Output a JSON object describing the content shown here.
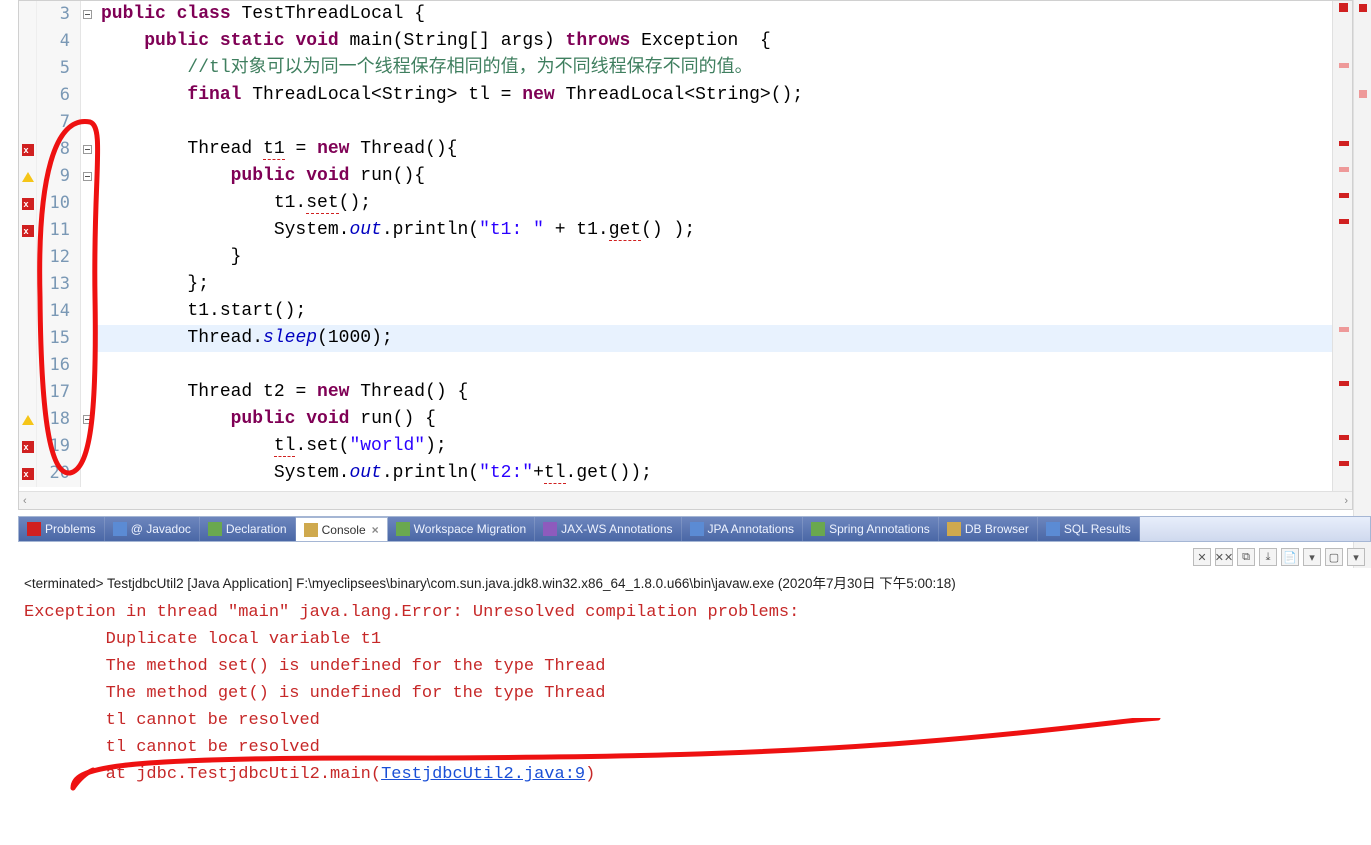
{
  "editor": {
    "lines": [
      {
        "n": 3,
        "fold": true
      },
      {
        "n": 4
      },
      {
        "n": 5
      },
      {
        "n": 6
      },
      {
        "n": 7
      },
      {
        "n": 8,
        "fold": true,
        "marker": "err"
      },
      {
        "n": 9,
        "fold": true,
        "marker": "warn"
      },
      {
        "n": 10,
        "marker": "err"
      },
      {
        "n": 11,
        "marker": "err"
      },
      {
        "n": 12
      },
      {
        "n": 13
      },
      {
        "n": 14
      },
      {
        "n": 15,
        "hl": true
      },
      {
        "n": 16
      },
      {
        "n": 17
      },
      {
        "n": 18,
        "fold": true,
        "marker": "warn"
      },
      {
        "n": 19,
        "marker": "err"
      },
      {
        "n": 20,
        "marker": "err"
      }
    ],
    "code": {
      "3": {
        "pre": "",
        "parts": [
          [
            "kw",
            "public"
          ],
          [
            "",
            " "
          ],
          [
            "kw",
            "class"
          ],
          [
            "",
            " TestThreadLocal {"
          ]
        ]
      },
      "4": {
        "pre": "    ",
        "parts": [
          [
            "kw",
            "public"
          ],
          [
            "",
            " "
          ],
          [
            "kw",
            "static"
          ],
          [
            "",
            " "
          ],
          [
            "kw",
            "void"
          ],
          [
            "",
            " main(String[] args) "
          ],
          [
            "kw",
            "throws"
          ],
          [
            "",
            " Exception  {"
          ]
        ]
      },
      "5": {
        "pre": "        ",
        "parts": [
          [
            "cm",
            "//tl对象可以为同一个线程保存相同的值，为不同线程保存不同的值。"
          ]
        ]
      },
      "6": {
        "pre": "        ",
        "parts": [
          [
            "kw",
            "final"
          ],
          [
            "",
            " ThreadLocal<String> tl = "
          ],
          [
            "kw",
            "new"
          ],
          [
            "",
            " ThreadLocal<String>();"
          ]
        ]
      },
      "7": {
        "pre": "",
        "parts": [
          [
            "",
            ""
          ]
        ]
      },
      "8": {
        "pre": "        ",
        "parts": [
          [
            "",
            "Thread "
          ],
          [
            "err",
            "t1"
          ],
          [
            "",
            " = "
          ],
          [
            "kw",
            "new"
          ],
          [
            "",
            " Thread(){"
          ]
        ]
      },
      "9": {
        "pre": "            ",
        "parts": [
          [
            "kw",
            "public"
          ],
          [
            "",
            " "
          ],
          [
            "kw",
            "void"
          ],
          [
            "",
            " run(){"
          ]
        ]
      },
      "10": {
        "pre": "                ",
        "parts": [
          [
            "",
            "t1."
          ],
          [
            "err",
            "set"
          ],
          [
            "",
            "();"
          ]
        ]
      },
      "11": {
        "pre": "                ",
        "parts": [
          [
            "",
            "System."
          ],
          [
            "fld",
            "out"
          ],
          [
            "",
            ".println("
          ],
          [
            "str",
            "\"t1: \""
          ],
          [
            "",
            " + t1."
          ],
          [
            "err",
            "get"
          ],
          [
            "",
            "() );"
          ]
        ]
      },
      "12": {
        "pre": "            ",
        "parts": [
          [
            "",
            "}"
          ]
        ]
      },
      "13": {
        "pre": "        ",
        "parts": [
          [
            "",
            "};"
          ]
        ]
      },
      "14": {
        "pre": "        ",
        "parts": [
          [
            "",
            "t1.start();"
          ]
        ]
      },
      "15": {
        "pre": "        ",
        "parts": [
          [
            "",
            "Thread."
          ],
          [
            "fld",
            "sleep"
          ],
          [
            "",
            "(1000);"
          ]
        ]
      },
      "16": {
        "pre": "",
        "parts": [
          [
            "",
            ""
          ]
        ]
      },
      "17": {
        "pre": "        ",
        "parts": [
          [
            "",
            "Thread t2 = "
          ],
          [
            "kw",
            "new"
          ],
          [
            "",
            " Thread() {"
          ]
        ]
      },
      "18": {
        "pre": "            ",
        "parts": [
          [
            "kw",
            "public"
          ],
          [
            "",
            " "
          ],
          [
            "kw",
            "void"
          ],
          [
            "",
            " run() {"
          ]
        ]
      },
      "19": {
        "pre": "                ",
        "parts": [
          [
            "err",
            "tl"
          ],
          [
            "",
            ".set("
          ],
          [
            "str",
            "\"world\""
          ],
          [
            "",
            ");"
          ]
        ]
      },
      "20": {
        "pre": "                ",
        "parts": [
          [
            "",
            "System."
          ],
          [
            "fld",
            "out"
          ],
          [
            "",
            ".println("
          ],
          [
            "str",
            "\"t2:\""
          ],
          [
            "",
            "+"
          ],
          [
            "err",
            "tl"
          ],
          [
            "",
            ".get());"
          ]
        ]
      }
    }
  },
  "tabs": {
    "items": [
      {
        "id": "problems",
        "label": "Problems",
        "icon": "ti-prob"
      },
      {
        "id": "javadoc",
        "label": "Javadoc",
        "icon": "ti-jd",
        "at": "@ "
      },
      {
        "id": "declaration",
        "label": "Declaration",
        "icon": "ti-decl"
      },
      {
        "id": "console",
        "label": "Console",
        "icon": "ti-cons",
        "active": true,
        "close": true
      },
      {
        "id": "wsmig",
        "label": "Workspace Migration",
        "icon": "ti-ws"
      },
      {
        "id": "jaxws",
        "label": "JAX-WS Annotations",
        "icon": "ti-jax"
      },
      {
        "id": "jpa",
        "label": "JPA Annotations",
        "icon": "ti-jpa"
      },
      {
        "id": "spring",
        "label": "Spring Annotations",
        "icon": "ti-spring"
      },
      {
        "id": "dbbrowser",
        "label": "DB Browser",
        "icon": "ti-db"
      },
      {
        "id": "sqlres",
        "label": "SQL Results",
        "icon": "ti-sql"
      }
    ]
  },
  "console": {
    "launch": "<terminated> TestjdbcUtil2 [Java Application] F:\\myeclipsees\\binary\\com.sun.java.jdk8.win32.x86_64_1.8.0.u66\\bin\\javaw.exe (2020年7月30日 下午5:00:18)",
    "lines": [
      "Exception in thread \"main\" java.lang.Error: Unresolved compilation problems: ",
      "\tDuplicate local variable t1",
      "\tThe method set() is undefined for the type Thread",
      "\tThe method get() is undefined for the type Thread",
      "\ttl cannot be resolved",
      "\ttl cannot be resolved",
      ""
    ],
    "trace_prefix": "\tat jdbc.TestjdbcUtil2.main(",
    "trace_link": "TestjdbcUtil2.java:9",
    "trace_suffix": ")"
  },
  "toolbar_buttons": [
    "✕",
    "✕✕",
    "⧉",
    "⤓",
    "📄",
    "▾",
    "▢",
    "▾"
  ]
}
